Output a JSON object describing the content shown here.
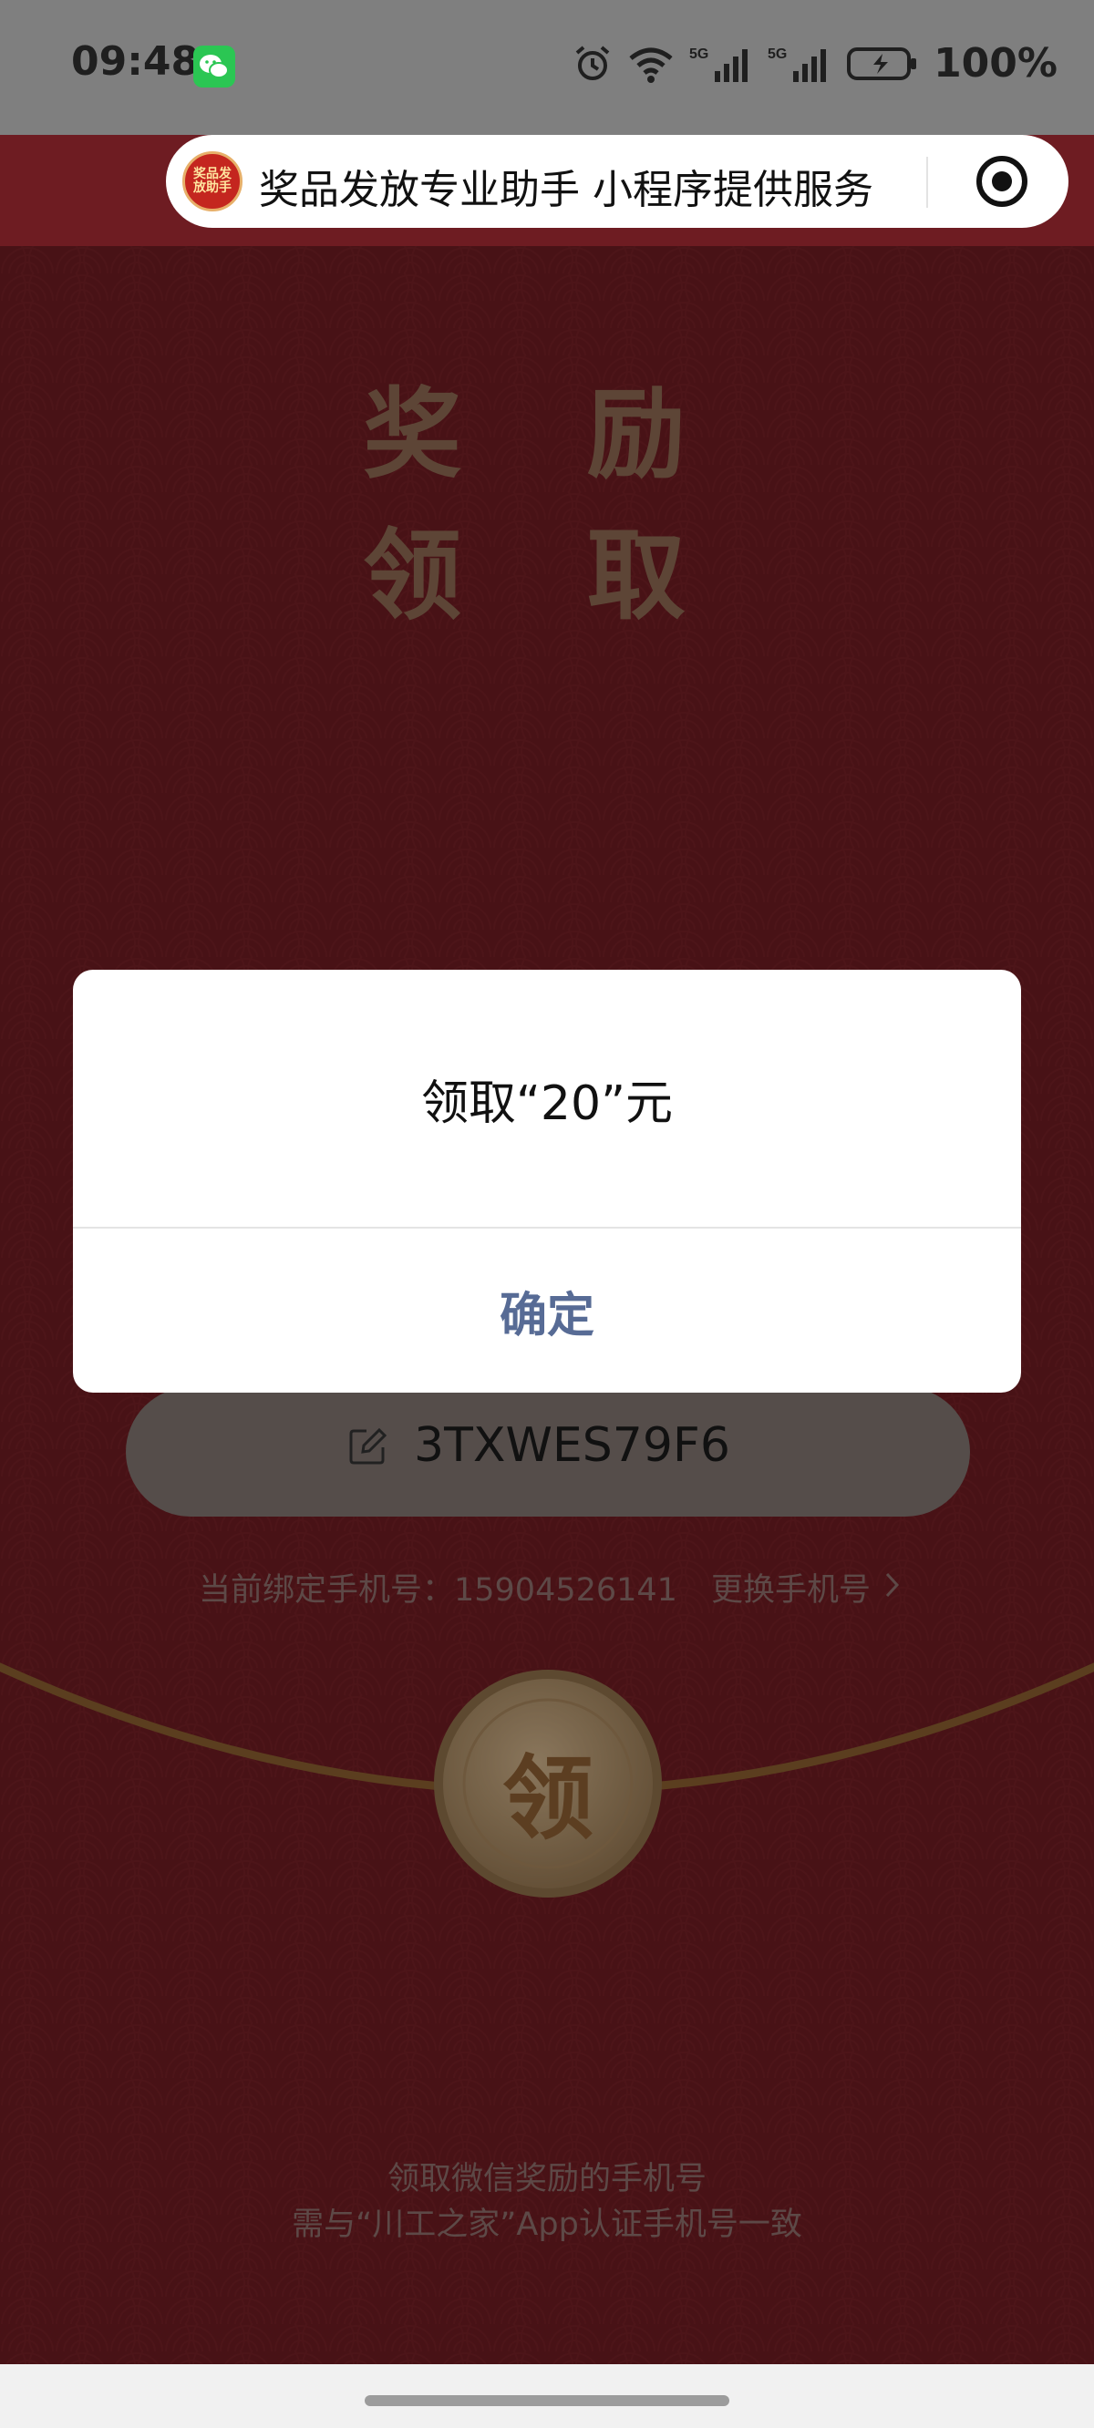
{
  "status_bar": {
    "time": "09:48",
    "battery": "100%",
    "icons": [
      "wechat-icon",
      "alarm-icon",
      "wifi-icon",
      "signal-5g-icon",
      "signal-5g-icon",
      "battery-charging-icon"
    ]
  },
  "mini_program": {
    "logo_text": "奖品发放助手",
    "title": "奖品发放专业助手 小程序提供服务"
  },
  "page": {
    "heading_line1": "奖 励",
    "heading_line2": "领 取",
    "redeem_code": "3TXWES79F6",
    "phone_label": "当前绑定手机号：15904526141",
    "change_phone": "更换手机号",
    "claim_button": "领",
    "footer_line1": "领取微信奖励的手机号",
    "footer_line2": "需与“川工之家”App认证手机号一致"
  },
  "dialog": {
    "message": "领取“20”元",
    "confirm": "确定"
  },
  "colors": {
    "page_bg": "#6e1c22",
    "gold": "#c8a46a",
    "dialog_button": "#576b95",
    "wechat_green": "#2bc653"
  }
}
